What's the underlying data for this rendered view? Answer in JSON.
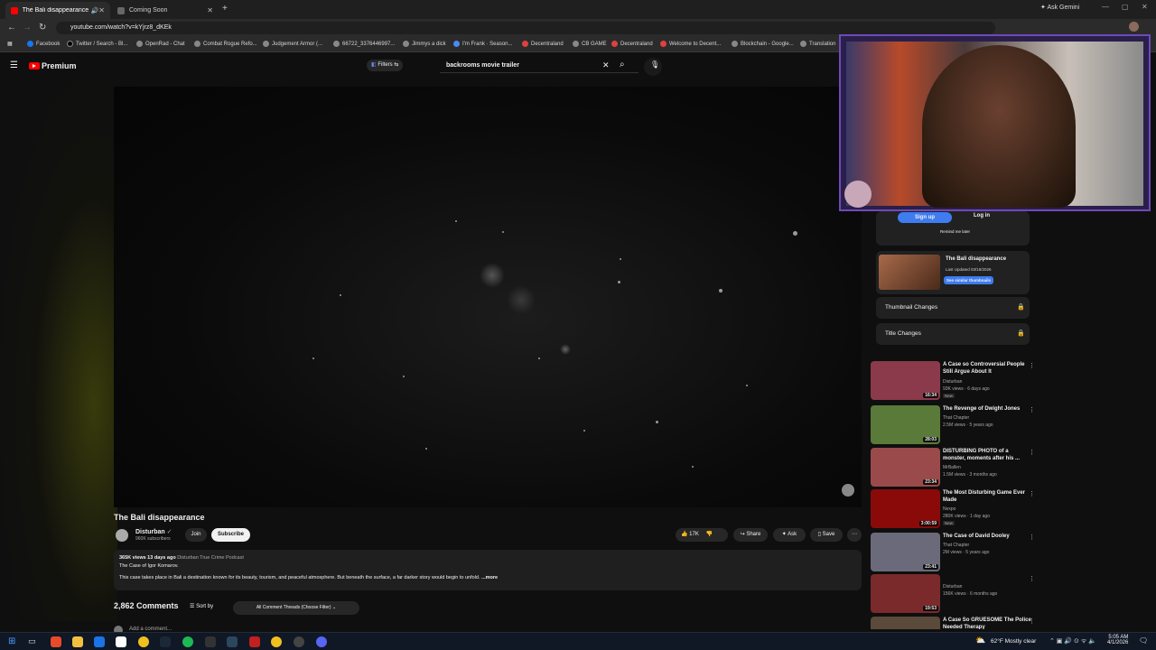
{
  "browser": {
    "tabs": [
      {
        "title": "The Bali disappearance - YouTube",
        "active": true
      },
      {
        "title": "Coming Soon",
        "active": false
      }
    ],
    "ask_gemini": "Ask Gemini",
    "url": "youtube.com/watch?v=kYjrz8_dKEk",
    "bookmarks": [
      "Facebook",
      "Twitter / Search - Bl...",
      "OpenRad - Chat",
      "Combat Rogue Refo...",
      "Judgement Armor (...",
      "66722_3376446997...",
      "Jimmys a dick",
      "I'm Frank · Season...",
      "Decentraland",
      "CB GAME",
      "Decentraland",
      "Welcome to Decent...",
      "Blockchain - Google...",
      "Translation"
    ]
  },
  "yt": {
    "logo_text": "Premium",
    "filters_label": "Filters",
    "search_value": "backrooms movie trailer"
  },
  "video": {
    "title": "The Bali disappearance",
    "channel": "Disturban",
    "subscribers": "960K subscribers",
    "join": "Join",
    "subscribe": "Subscribe",
    "likes": "17K",
    "share": "Share",
    "ask": "Ask",
    "save": "Save",
    "views_line": "365K views  13 days ago",
    "podcast": "Disturban True Crime Podcast",
    "case_line": "The Case of Igor Komarov.",
    "desc_text": "This case takes place in Bali a destination known for its beauty, tourism, and peaceful atmosphere. But beneath the surface, a far darker story would begin to unfold.",
    "more": "...more"
  },
  "comments": {
    "count_label": "2,862 Comments",
    "sort": "Sort by",
    "filter": "All Comment Threads (Choose Filter)",
    "add": "Add a comment..."
  },
  "sidebar": {
    "signup": "Sign up",
    "login": "Log in",
    "remind": "Remind me later",
    "ext_title": "The Bali disappearance",
    "ext_updated": "Last Updated 03/18/2026",
    "ext_similar": "See similar thumbnails",
    "thumb_changes": "Thumbnail Changes",
    "title_changes": "Title Changes",
    "recs": [
      {
        "title": "A Case so Controversial People Still Argue About It",
        "channel": "Disturban",
        "meta": "93K views · 6 days ago",
        "duration": "16:34",
        "new": "New",
        "color": "#8a3a4a"
      },
      {
        "title": "The Revenge of Dwight Jones",
        "channel": "That Chapter",
        "meta": "2.5M views · 5 years ago",
        "duration": "28:03",
        "new": "",
        "color": "#5a7a3a"
      },
      {
        "title": "DISTURBING PHOTO of a monster, moments after his ...",
        "channel": "MrBallen",
        "meta": "1.5M views · 3 months ago",
        "duration": "23:34",
        "new": "",
        "color": "#9a4a4a"
      },
      {
        "title": "The Most Disturbing Game Ever Made",
        "channel": "Nexpo",
        "meta": "280K views · 1 day ago",
        "duration": "3:00:59",
        "new": "New",
        "color": "#8a0a0a"
      },
      {
        "title": "The Case of David Dooley",
        "channel": "That Chapter",
        "meta": "2M views · 5 years ago",
        "duration": "23:41",
        "new": "",
        "color": "#6a6a7a"
      },
      {
        "title": "",
        "channel": "Disturban",
        "meta": "156K views · 6 months ago",
        "duration": "19:53",
        "new": "",
        "color": "#7a2a2a"
      },
      {
        "title": "A Case So GRUESOME The Police Needed Therapy",
        "channel": "",
        "meta": "",
        "duration": "",
        "new": "",
        "color": "#5a4a3a"
      }
    ]
  },
  "taskbar": {
    "weather": "62°F  Mostly clear",
    "time": "5:05 AM",
    "date": "4/1/2026"
  }
}
